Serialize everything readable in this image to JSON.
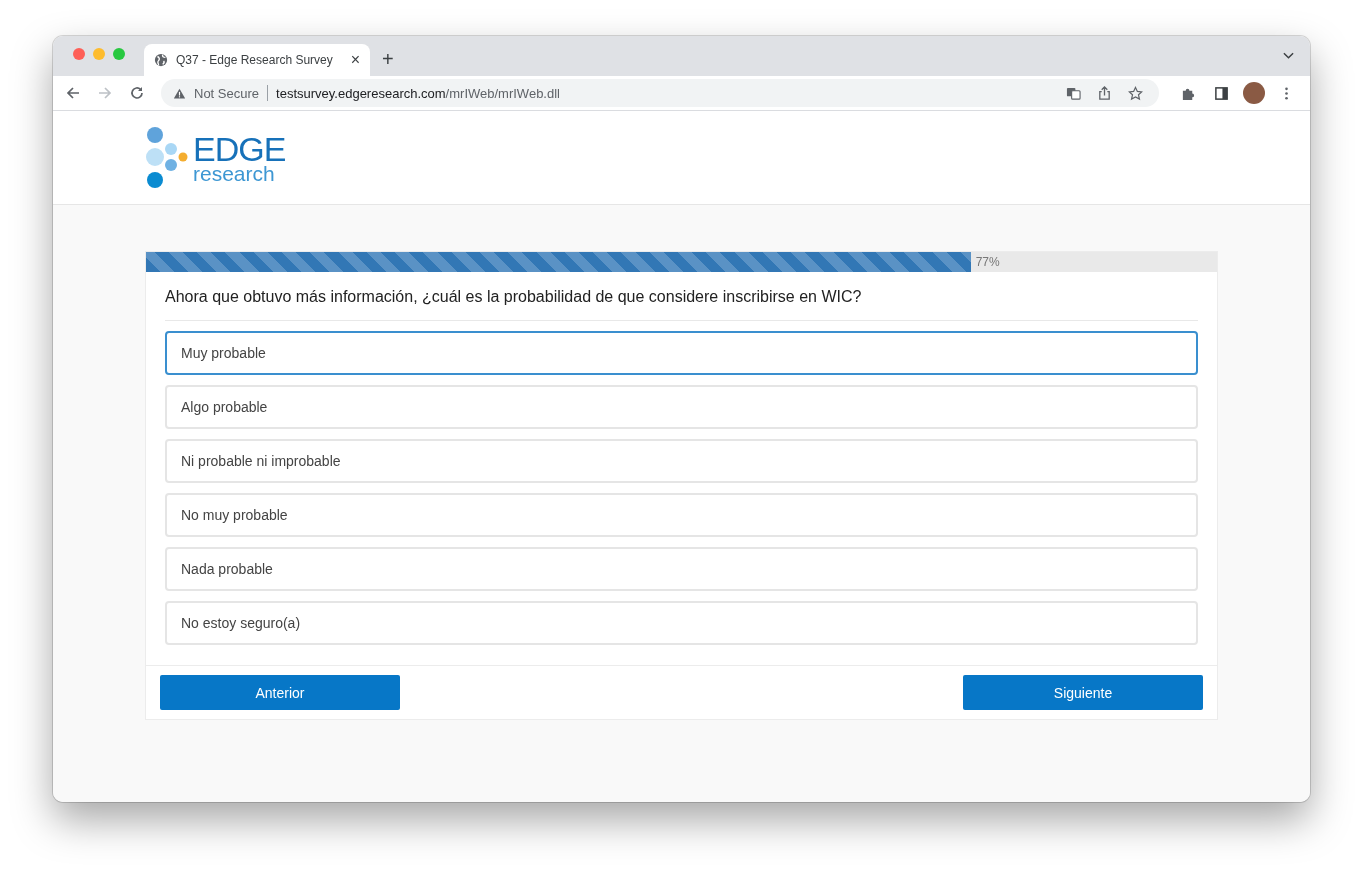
{
  "browser": {
    "tab_title": "Q37 - Edge Research Survey",
    "tab_close": "×",
    "new_tab": "+",
    "security": "Not Secure",
    "url_host": "testsurvey.edgeresearch.com",
    "url_path": "/mrIWeb/mrIWeb.dll"
  },
  "logo": {
    "word": "EDGE",
    "sub": "research"
  },
  "progress": {
    "level": 0.77,
    "label": "77%"
  },
  "question": "Ahora que obtuvo más información, ¿cuál es la probabilidad de que considere inscribirse en WIC?",
  "options": [
    {
      "label": "Muy probable",
      "selected": true
    },
    {
      "label": "Algo probable",
      "selected": false
    },
    {
      "label": "Ni probable ni improbable",
      "selected": false
    },
    {
      "label": "No muy probable",
      "selected": false
    },
    {
      "label": "Nada probable",
      "selected": false
    },
    {
      "label": "No estoy seguro(a)",
      "selected": false
    }
  ],
  "buttons": {
    "back": "Anterior",
    "next": "Siguiente"
  }
}
